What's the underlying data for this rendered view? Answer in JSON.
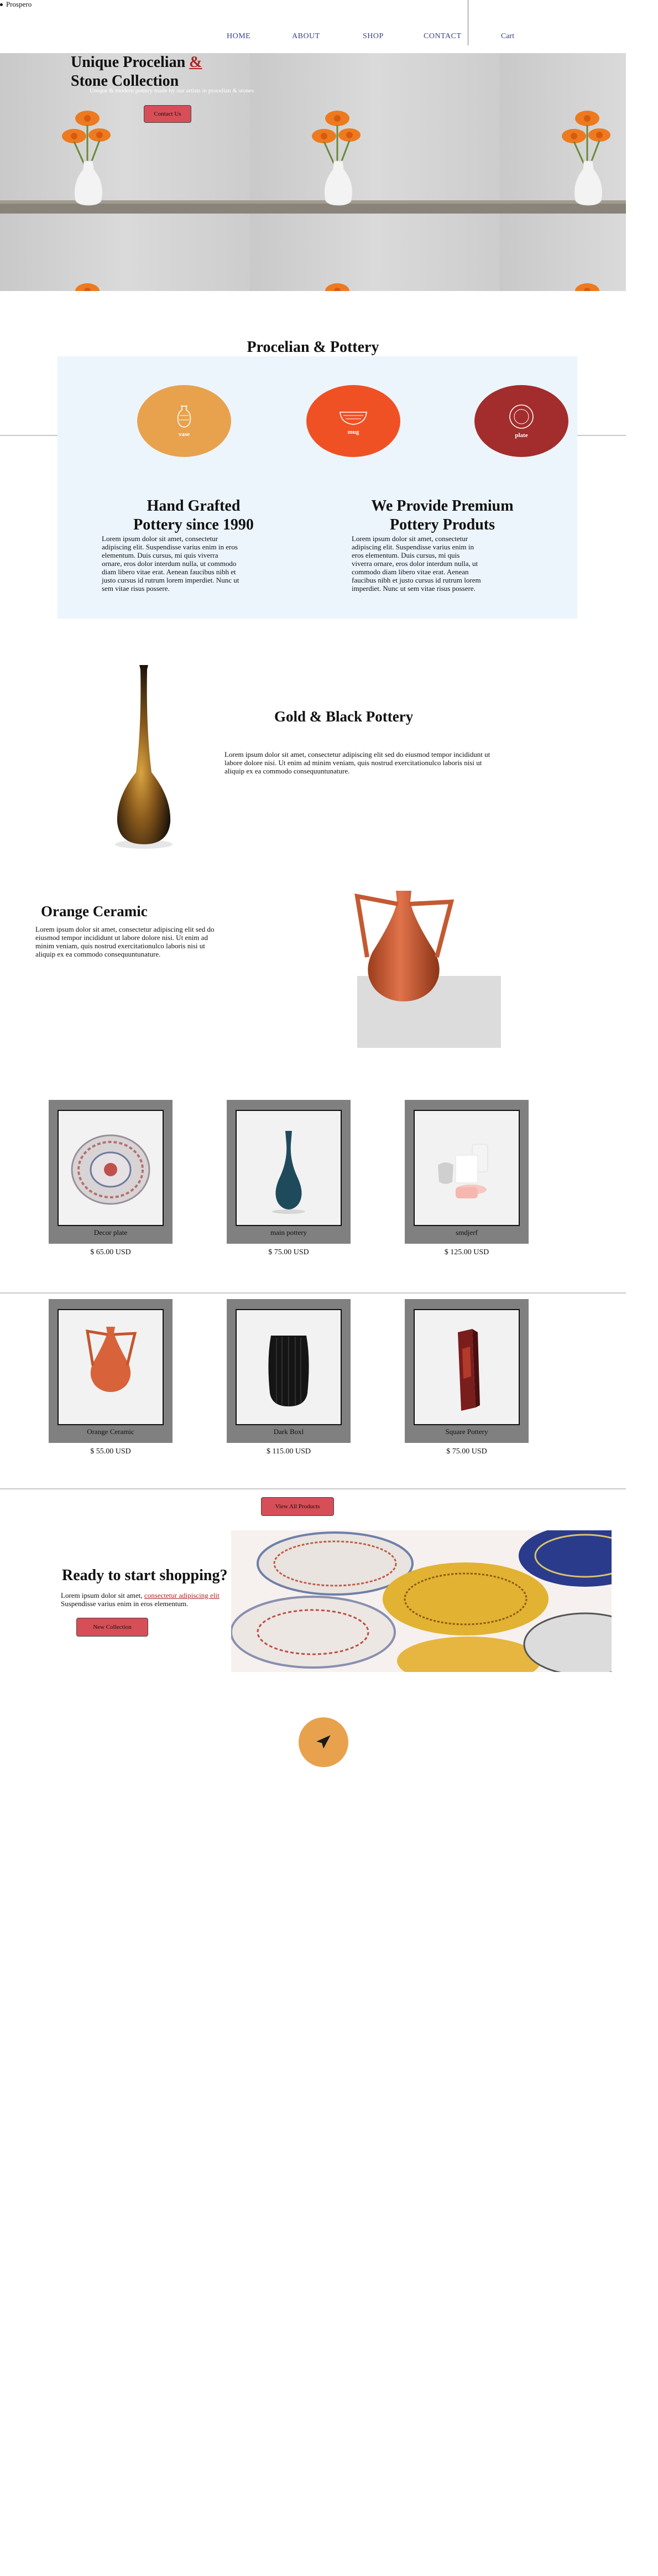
{
  "brand": {
    "name": "Prospero"
  },
  "nav": {
    "links": [
      "HOME",
      "ABOUT",
      "SHOP",
      "CONTACT"
    ],
    "cart": "Cart"
  },
  "hero": {
    "title_line1": "Unique Procelian",
    "title_amp": "&",
    "title_line2": "Stone Collection",
    "subtitle": "Unique & modern pottery made by our artists in procelian & stones",
    "button": "Contact Us"
  },
  "categories": {
    "title": "Procelian & Pottery",
    "items": [
      {
        "label": "vase",
        "color": "#e8a24e"
      },
      {
        "label": "mug",
        "color": "#f05124"
      },
      {
        "label": "plate",
        "color": "#a32d2d"
      }
    ]
  },
  "features": [
    {
      "title_line1": "Hand Grafted",
      "title_line2": "Pottery since 1990",
      "body": "Lorem ipsum dolor sit amet, consectetur adipiscing elit. Suspendisse varius enim in eros elementum. Duis cursus, mi quis viverra ornare, eros dolor interdum nulla, ut commodo diam libero vitae erat. Aenean faucibus nibh et justo cursus id rutrum lorem imperdiet. Nunc ut sem vitae risus possere."
    },
    {
      "title_line1": "We Provide Premium",
      "title_line2": "Pottery Produts",
      "body": "Lorem ipsum dolor sit amet, consectetur adipiscing elit. Suspendisse varius enim in eros elementum. Duis cursus, mi quis viverra ornare, eros dolor interdum nulla, ut commodo diam libero vitae erat. Aenean faucibus nibh et justo cursus id rutrum lorem imperdiet. Nunc ut sem vitae risus possere."
    }
  ],
  "gold": {
    "title": "Gold & Black Pottery",
    "body": "Lorem ipsum dolor sit amet, consectetur adipiscing elit sed do eiusmod tempor incididunt ut labore dolore nisi. Ut enim ad minim veniam, quis nostrud exercitationulco laboris nisi ut aliquip ex ea commodo consequuntunature."
  },
  "orange": {
    "title": "Orange Ceramic",
    "body": "Lorem ipsum dolor sit amet, consectetur adipiscing elit sed do eiusmod tempor incididunt ut labore dolore nisi. Ut enim ad minim veniam, quis nostrud exercitationulco laboris nisi ut aliquip ex ea commodo consequuntunature."
  },
  "products": [
    {
      "name": "Decor plate",
      "price": "$ 65.00 USD"
    },
    {
      "name": "main pottery",
      "price": "$ 75.00 USD"
    },
    {
      "name": "smdjerf",
      "price": "$ 125.00 USD"
    },
    {
      "name": "Orange Ceramic",
      "price": "$ 55.00 USD"
    },
    {
      "name": "Dark Boxl",
      "price": "$ 115.00 USD"
    },
    {
      "name": "Square Pottery",
      "price": "$ 75.00 USD"
    }
  ],
  "view_all": "View All Products",
  "ready": {
    "title": "Ready to start shopping?",
    "body_start": "Lorem ipsum dolor sit amet,",
    "body_link": "consectetur adipiscing elit",
    "body_end": "Suspendisse varius enim in eros elementum.",
    "button": "New Collection"
  },
  "colors": {
    "accent_button": "#d64e57",
    "panel_bg": "#edf5fc",
    "card_frame": "#808080",
    "send_button": "#e8a24e"
  },
  "icons": {
    "send": "paper-plane-icon",
    "vase": "vase-icon",
    "mug": "bowl-icon",
    "plate": "plate-icon"
  }
}
